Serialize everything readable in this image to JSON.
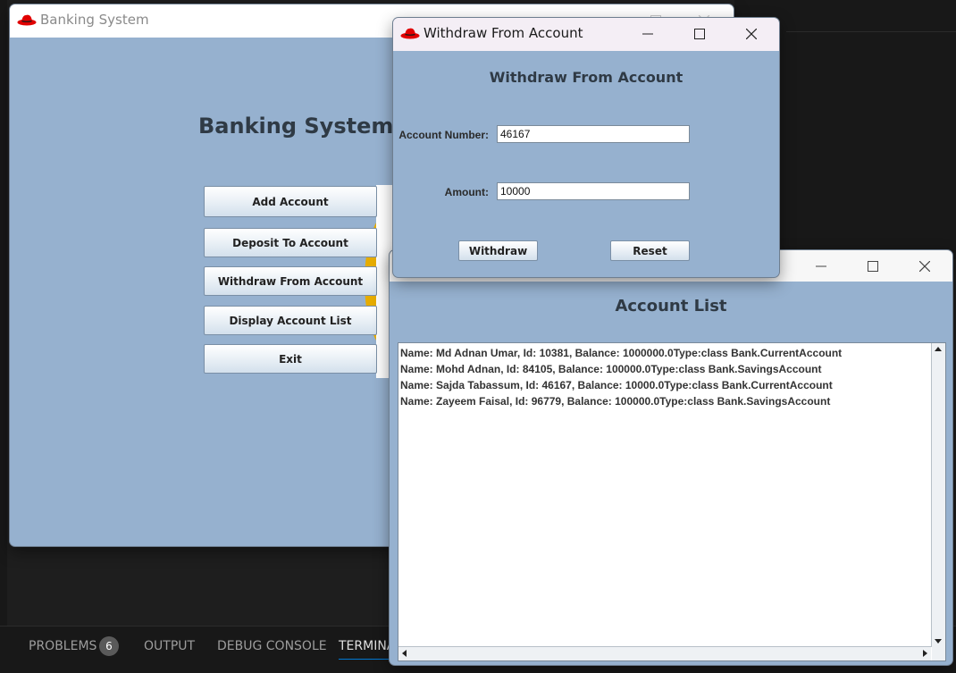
{
  "vscode": {
    "tabs": [
      "PROBLEMS",
      "OUTPUT",
      "DEBUG CONSOLE",
      "TERMINA"
    ],
    "problems_count": "6"
  },
  "main_window": {
    "title": "Banking System",
    "heading": "Banking System",
    "buttons": [
      "Add Account",
      "Deposit To Account",
      "Withdraw From Account",
      "Display Account List",
      "Exit"
    ]
  },
  "withdraw_window": {
    "title": "Withdraw From Account",
    "heading": "Withdraw From Account",
    "account_label": "Account Number:",
    "account_value": "46167",
    "amount_label": "Amount:",
    "amount_value": "10000",
    "withdraw_button": "Withdraw",
    "reset_button": "Reset"
  },
  "list_window": {
    "heading": "Account List",
    "lines": [
      "Name: Md Adnan Umar, Id: 10381, Balance: 1000000.0Type:class Bank.CurrentAccount",
      "Name: Mohd Adnan, Id: 84105, Balance: 100000.0Type:class Bank.SavingsAccount",
      "Name: Sajda Tabassum, Id: 46167, Balance: 10000.0Type:class Bank.CurrentAccount",
      "Name: Zayeem Faisal, Id: 96779, Balance: 100000.0Type:class Bank.SavingsAccount"
    ]
  },
  "icons": {
    "app": "red-hat-icon",
    "minimize": "minimize-icon",
    "maximize": "maximize-icon",
    "close": "close-icon"
  },
  "colors": {
    "window_bg": "#96b1cf",
    "vscode_bg": "#1e1e1e",
    "accent": "#0078d4",
    "hat_red": "#e00000"
  }
}
